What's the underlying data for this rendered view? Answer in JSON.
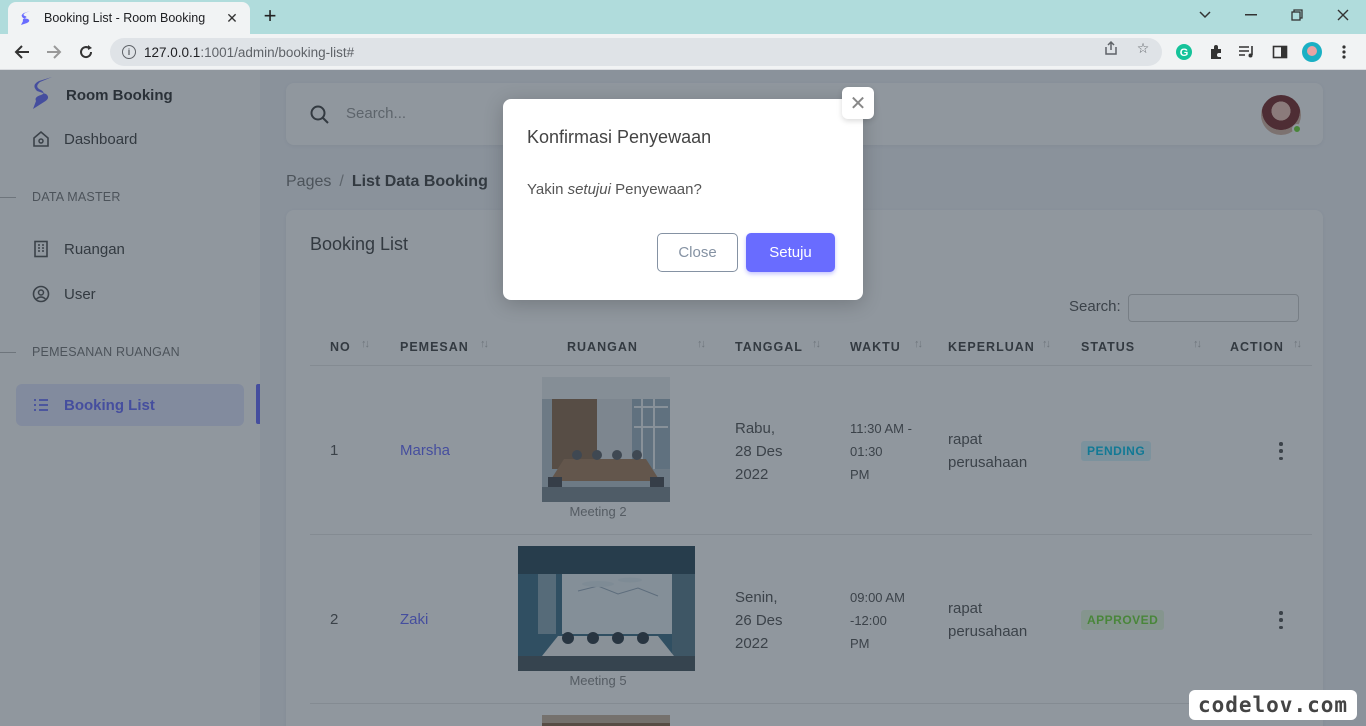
{
  "browser": {
    "tab_title": "Booking List - Room Booking",
    "url_host": "127.0.0.1",
    "url_rest": ":1001/admin/booking-list#"
  },
  "sidebar": {
    "brand": "Room Booking",
    "dashboard": "Dashboard",
    "section_master": "DATA MASTER",
    "ruangan": "Ruangan",
    "user": "User",
    "section_pemesanan": "PEMESANAN RUANGAN",
    "booking_list": "Booking List"
  },
  "topnav": {
    "search_placeholder": "Search..."
  },
  "breadcrumb": {
    "parent": "Pages",
    "sep": "/",
    "current": "List Data Booking"
  },
  "card": {
    "title": "Booking List",
    "search_label": "Search:",
    "columns": [
      "NO",
      "PEMESAN",
      "RUANGAN",
      "TANGGAL",
      "WAKTU",
      "KEPERLUAN",
      "STATUS",
      "ACTION"
    ],
    "rows": [
      {
        "no": "1",
        "pemesan": "Marsha",
        "ruangan": "Meeting 2",
        "tanggal_1": "Rabu,",
        "tanggal_2": "28 Des",
        "tanggal_3": "2022",
        "waktu_1": "11:30 AM -",
        "waktu_2": "01:30",
        "waktu_3": "PM",
        "keperluan_1": "rapat",
        "keperluan_2": "perusahaan",
        "status": "PENDING"
      },
      {
        "no": "2",
        "pemesan": "Zaki",
        "ruangan": "Meeting 5",
        "tanggal_1": "Senin,",
        "tanggal_2": "26 Des",
        "tanggal_3": "2022",
        "waktu_1": "09:00 AM",
        "waktu_2": "-12:00",
        "waktu_3": "PM",
        "keperluan_1": "rapat",
        "keperluan_2": "perusahaan",
        "status": "APPROVED"
      }
    ]
  },
  "modal": {
    "title": "Konfirmasi Penyewaan",
    "body_pre": "Yakin ",
    "body_em": "setujui",
    "body_post": " Penyewaan?",
    "close_label": "Close",
    "confirm_label": "Setuju"
  },
  "watermark": "codelov.com",
  "colors": {
    "primary": "#696cff",
    "pending": "#03c3ec",
    "approved": "#71dd37"
  }
}
